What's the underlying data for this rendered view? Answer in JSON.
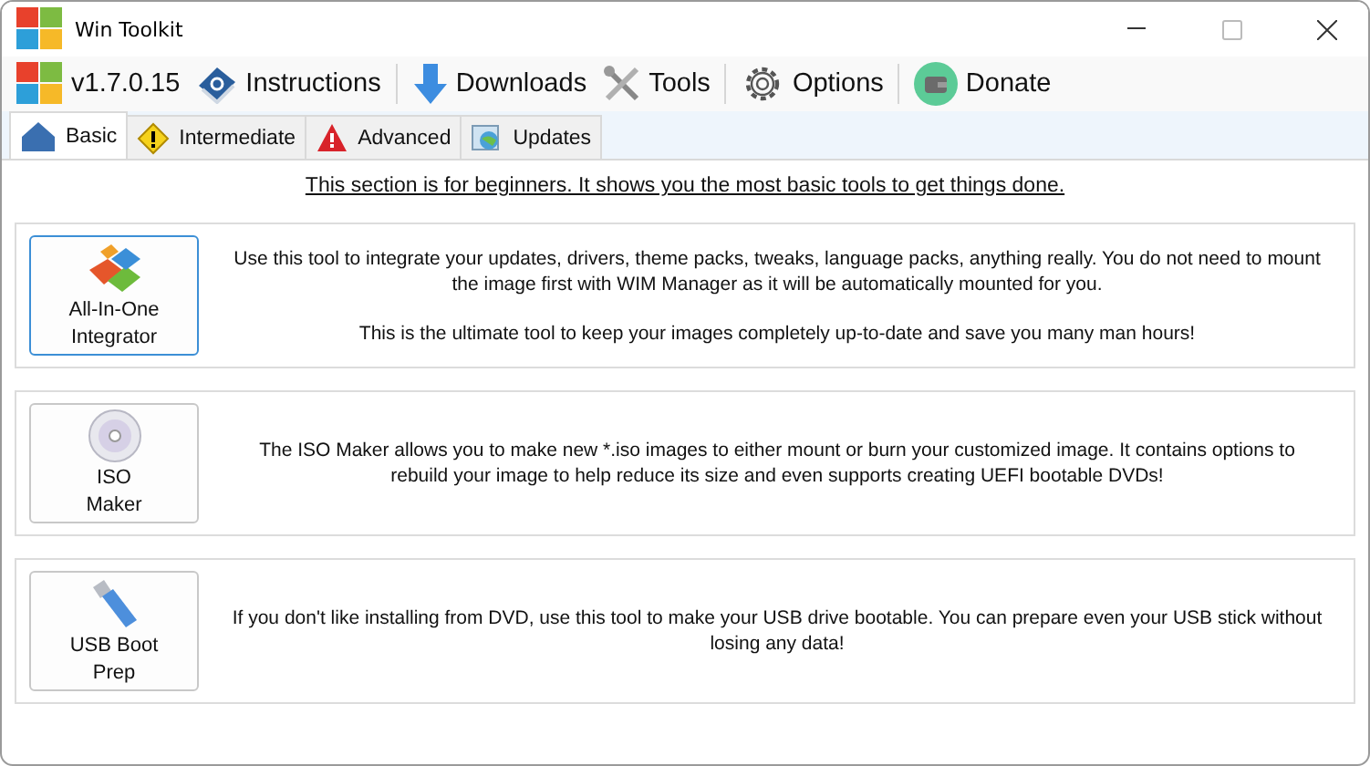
{
  "window": {
    "title": "Win Toolkit"
  },
  "toolbar": [
    {
      "kind": "windows",
      "label": "v1.7.0.15",
      "separator_before": false
    },
    {
      "kind": "book",
      "label": "Instructions",
      "separator_before": false
    },
    {
      "kind": "download",
      "label": "Downloads",
      "separator_before": true
    },
    {
      "kind": "tools",
      "label": "Tools",
      "separator_before": false
    },
    {
      "kind": "gear",
      "label": "Options",
      "separator_before": true
    },
    {
      "kind": "wallet",
      "label": "Donate",
      "separator_before": true
    }
  ],
  "tabs": [
    {
      "kind": "house",
      "label": "Basic",
      "selected": true
    },
    {
      "kind": "warning",
      "label": "Intermediate",
      "selected": false
    },
    {
      "kind": "danger",
      "label": "Advanced",
      "selected": false
    },
    {
      "kind": "globe",
      "label": "Updates",
      "selected": false
    }
  ],
  "intro": "This section is for beginners. It shows you the most basic tools to get things done.",
  "tools": [
    {
      "kind": "integrator",
      "label_lines": [
        "All-In-One",
        "Integrator"
      ],
      "focused": true,
      "paragraphs": [
        "Use this tool to integrate your updates, drivers, theme packs, tweaks, language packs, anything really. You do not need to mount the image first with WIM Manager as it will be automatically mounted for you.",
        "This is the ultimate tool to keep your images completely up-to-date and save you many man hours!"
      ]
    },
    {
      "kind": "disc",
      "label_lines": [
        "ISO",
        "Maker"
      ],
      "focused": false,
      "paragraphs": [
        "The ISO Maker allows you to make new *.iso images to either mount or burn your customized image. It contains options to rebuild your image to help reduce its size and even supports creating UEFI bootable DVDs!"
      ]
    },
    {
      "kind": "usb",
      "label_lines": [
        "USB Boot",
        "Prep"
      ],
      "focused": false,
      "paragraphs": [
        "If you don't like installing from DVD, use this tool to make your USB drive bootable. You can prepare even your USB stick without losing any data!"
      ]
    }
  ]
}
